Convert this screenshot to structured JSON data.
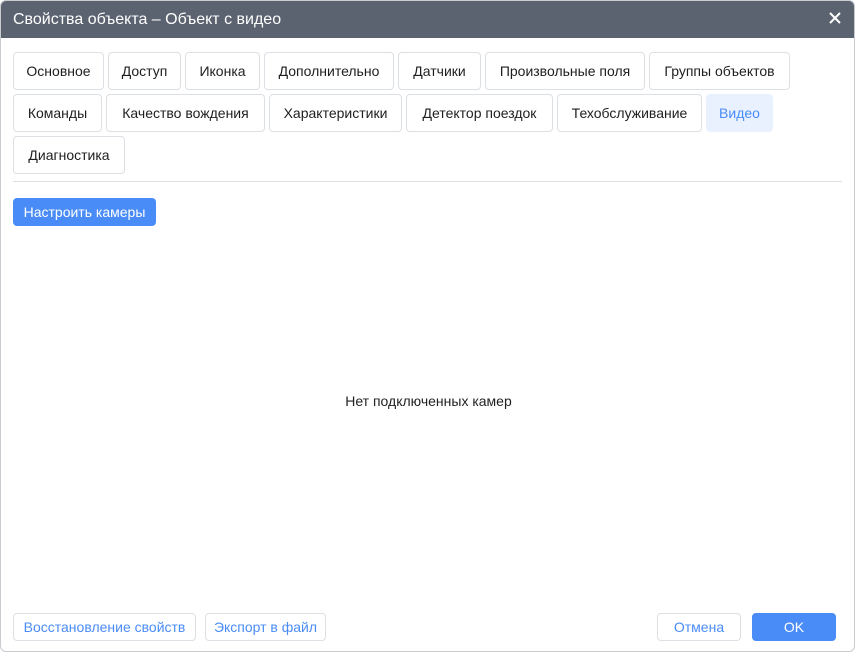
{
  "dialog": {
    "title": "Свойства объекта – Объект с видео"
  },
  "tabs": [
    {
      "label": "Основное"
    },
    {
      "label": "Доступ"
    },
    {
      "label": "Иконка"
    },
    {
      "label": "Дополнительно"
    },
    {
      "label": "Датчики"
    },
    {
      "label": "Произвольные поля"
    },
    {
      "label": "Группы объектов"
    },
    {
      "label": "Команды"
    },
    {
      "label": "Качество вождения"
    },
    {
      "label": "Характеристики"
    },
    {
      "label": "Детектор поездок"
    },
    {
      "label": "Техобслуживание"
    },
    {
      "label": "Видео",
      "active": true
    },
    {
      "label": "Диагностика"
    }
  ],
  "content": {
    "configure_cameras": "Настроить камеры",
    "empty_message": "Нет подключенных камер"
  },
  "footer": {
    "restore": "Восстановление свойств",
    "export": "Экспорт в файл",
    "cancel": "Отмена",
    "ok": "OK"
  }
}
